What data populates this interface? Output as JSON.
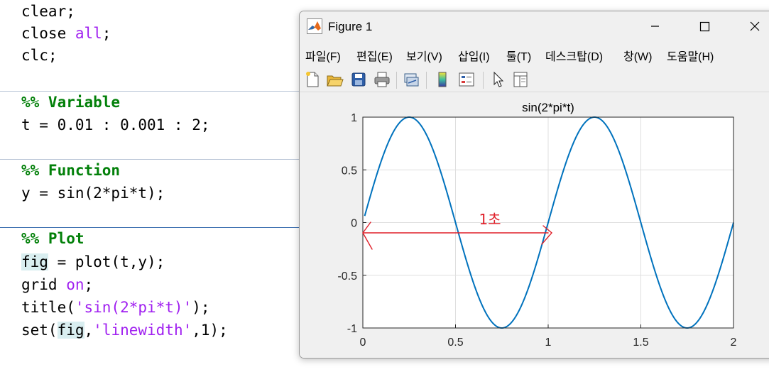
{
  "editor": {
    "lines": {
      "clear": "clear;",
      "close_fn": "close ",
      "close_arg": "all",
      "close_end": ";",
      "clc": "clc;",
      "sec1": "%% Variable",
      "t_assign": "t = 0.01 : 0.001 : 2;",
      "sec2": "%% Function",
      "y_assign": "y = sin(2*pi*t);",
      "sec3": "%% Plot",
      "fig_var": "fig",
      "fig_rest": " = plot(t,y);",
      "grid_fn": "grid ",
      "grid_arg": "on",
      "grid_end": ";",
      "title_fn": "title(",
      "title_arg": "'sin(2*pi*t)'",
      "title_end": ");",
      "set_fn": "set(",
      "set_fig": "fig",
      "set_comma": ",",
      "set_arg": "'linewidth'",
      "set_end": ",1);"
    },
    "colors": {
      "keyword": "#a020f0",
      "comment": "#028009",
      "highlight": "#d9eef0"
    }
  },
  "figure": {
    "window_title": "Figure 1",
    "menu": [
      "파일(F)",
      "편집(E)",
      "보기(V)",
      "삽입(I)",
      "툴(T)",
      "데스크탑(D)",
      "창(W)",
      "도움말(H)"
    ],
    "toolbar_icons": [
      "new-figure-icon",
      "open-file-icon",
      "save-icon",
      "print-icon",
      "link-plot-icon",
      "colorbar-icon",
      "legend-icon",
      "pointer-icon",
      "property-editor-icon"
    ],
    "annotation": {
      "text": "1초",
      "color": "#e0202a"
    }
  },
  "chart_data": {
    "type": "line",
    "title": "sin(2*pi*t)",
    "xlabel": "",
    "ylabel": "",
    "xlim": [
      0,
      2
    ],
    "ylim": [
      -1,
      1
    ],
    "xticks": [
      "0",
      "0.5",
      "1",
      "1.5",
      "2"
    ],
    "yticks": [
      "1",
      "0.5",
      "0",
      "-0.5",
      "-1"
    ],
    "grid": true,
    "series": [
      {
        "function": "sin(2*pi*t)",
        "x_start": 0.01,
        "x_end": 2,
        "x_step": 0.001,
        "color": "#0072bd"
      }
    ]
  }
}
